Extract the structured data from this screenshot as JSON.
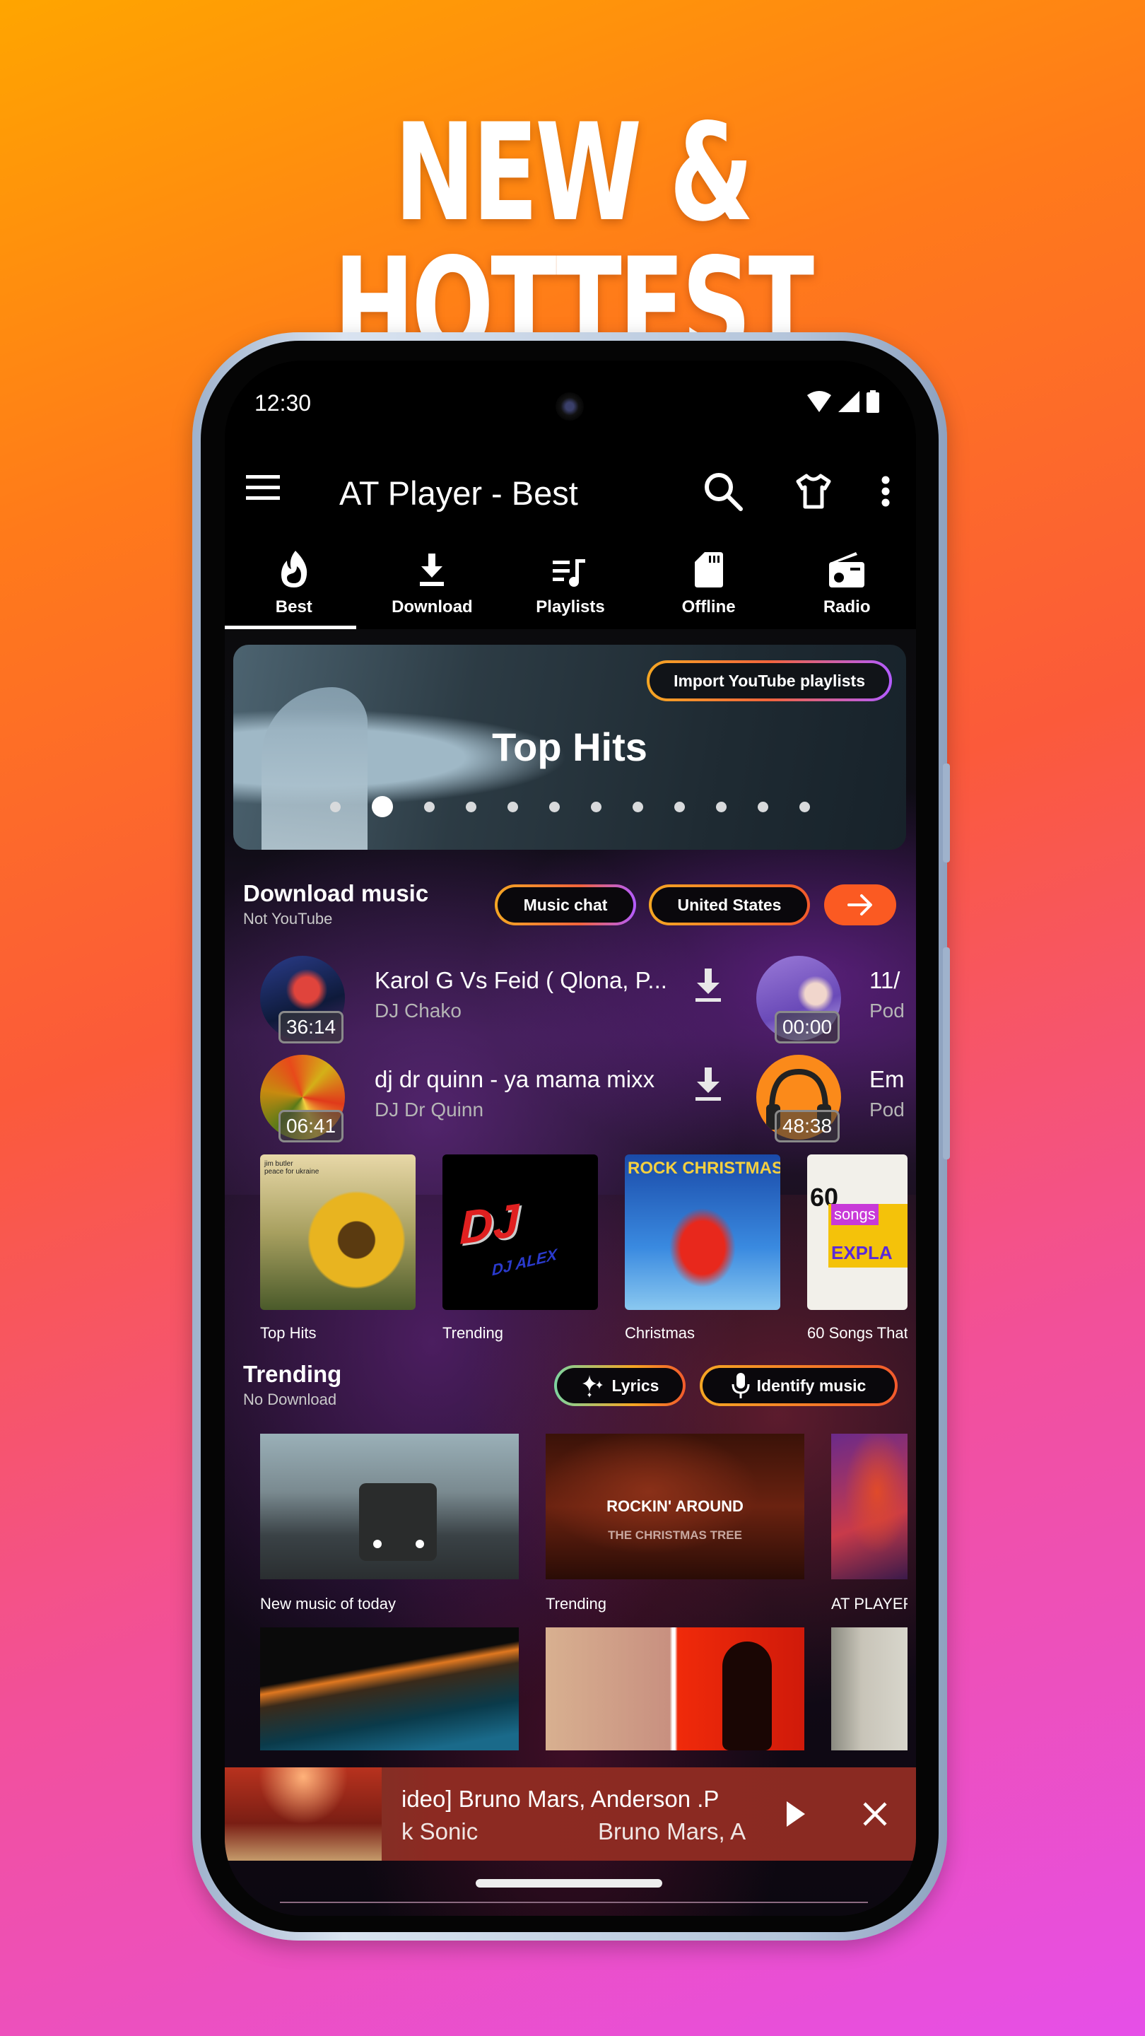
{
  "promo": {
    "headline": "NEW & HOTTEST MUSIC"
  },
  "status_bar": {
    "time": "12:30",
    "icons": [
      "wifi-icon",
      "signal-icon",
      "battery-icon"
    ]
  },
  "app_bar": {
    "title": "AT Player - Best",
    "actions": [
      "menu-icon",
      "search-icon",
      "tshirt-theme-icon",
      "more-vert-icon"
    ]
  },
  "tabs": [
    {
      "label": "Best",
      "icon": "fire-icon",
      "active": true
    },
    {
      "label": "Download",
      "icon": "download-icon",
      "active": false
    },
    {
      "label": "Playlists",
      "icon": "playlist-icon",
      "active": false
    },
    {
      "label": "Offline",
      "icon": "sd-card-icon",
      "active": false
    },
    {
      "label": "Radio",
      "icon": "radio-icon",
      "active": false
    }
  ],
  "banner": {
    "title": "Top Hits",
    "import_button": "Import YouTube playlists",
    "page_count": 12,
    "active_page": 2
  },
  "download_section": {
    "title": "Download music",
    "subtitle": "Not YouTube",
    "buttons": {
      "music_chat": "Music chat",
      "country": "United States"
    },
    "tracks": [
      {
        "title": "Karol G Vs Feid ( Qlona, P...",
        "artist": "DJ Chako",
        "duration": "36:14"
      },
      {
        "title": "dj dr quinn - ya mama mixx",
        "artist": "DJ Dr Quinn",
        "duration": "06:41"
      }
    ],
    "podcasts": [
      {
        "title": "11/",
        "subtitle": "Pod",
        "duration": "00:00"
      },
      {
        "title": "Em",
        "subtitle": "Pod",
        "duration": "48:38"
      }
    ]
  },
  "albums": [
    {
      "label": "Top Hits",
      "cover_text": "jim butler\npeace for ukraine"
    },
    {
      "label": "Trending",
      "cover_text": "DJ ALEX"
    },
    {
      "label": "Christmas",
      "cover_text": "ROCK CHRISTMAS"
    },
    {
      "label": "60 Songs That",
      "cover_text": "60 songs"
    }
  ],
  "trending_section": {
    "title": "Trending",
    "subtitle": "No Download",
    "buttons": {
      "lyrics": "Lyrics",
      "identify": "Identify music"
    },
    "videos_row1": [
      {
        "label": "New music of today",
        "overlay": ""
      },
      {
        "label": "Trending",
        "overlay": "ROCKIN' AROUND",
        "overlay2": "THE CHRISTMAS TREE"
      },
      {
        "label": "AT PLAYER",
        "overlay": ""
      }
    ]
  },
  "mini_player": {
    "title": "ideo] Bruno Mars, Anderson .P",
    "subtitle_left": "k Sonic",
    "subtitle_right": "Bruno Mars, A"
  }
}
